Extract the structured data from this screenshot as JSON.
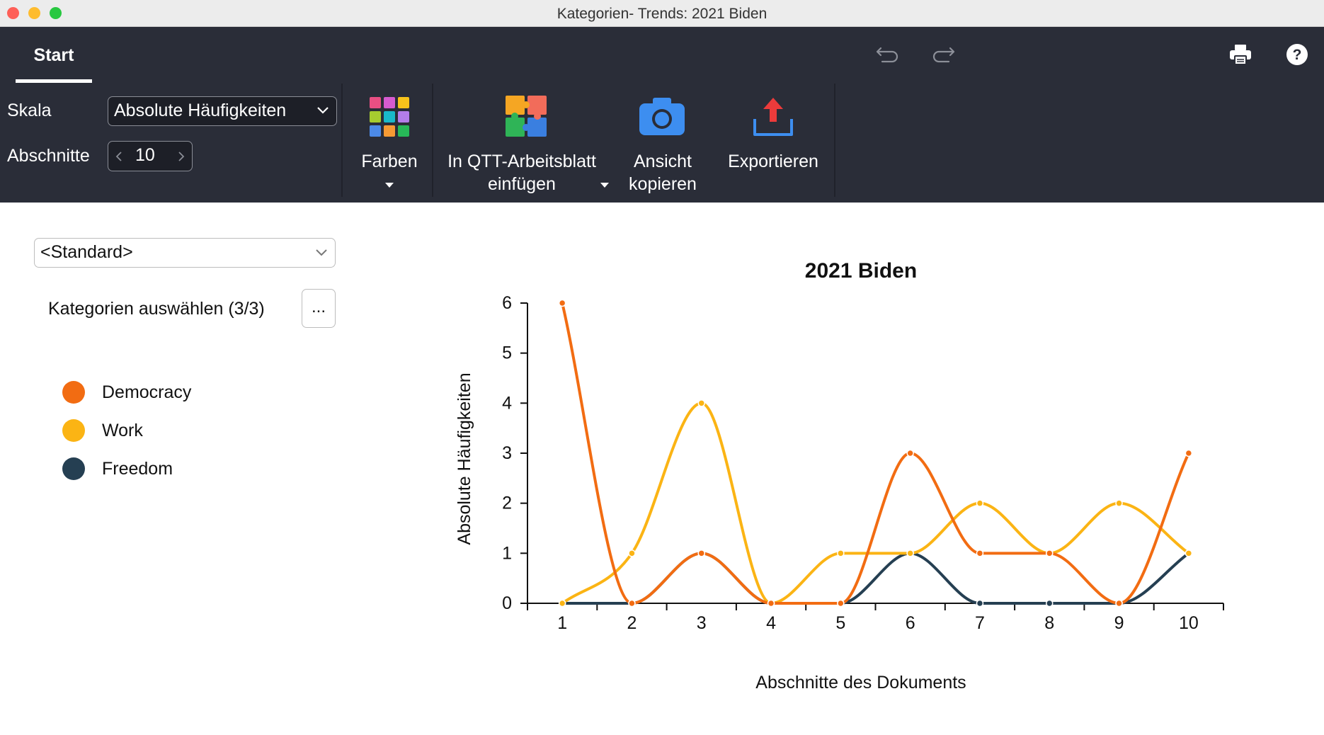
{
  "window": {
    "title": "Kategorien- Trends: 2021 Biden"
  },
  "tabs": [
    {
      "label": "Start"
    }
  ],
  "ribbon": {
    "skala_label": "Skala",
    "skala_value": "Absolute Häufigkeiten",
    "abschnitte_label": "Abschnitte",
    "abschnitte_value": "10",
    "farben_label": "Farben",
    "qtt_label_line1": "In QTT-Arbeitsblatt",
    "qtt_label_line2": "einfügen",
    "ansicht_line1": "Ansicht",
    "ansicht_line2": "kopieren",
    "export_label": "Exportieren"
  },
  "sidebar": {
    "preset_value": "<Standard>",
    "kategorien_label": "Kategorien auswählen (3/3)",
    "kategorien_button": "...",
    "legend": [
      {
        "name": "Democracy",
        "color": "#f26c12"
      },
      {
        "name": "Work",
        "color": "#fbb414"
      },
      {
        "name": "Freedom",
        "color": "#253f52"
      }
    ]
  },
  "colors": {
    "toolbar_bg": "#2a2d38",
    "farben_grid": [
      "#e94f83",
      "#d65bd0",
      "#f7c31b",
      "#a6cc2f",
      "#19b9c9",
      "#b37de9",
      "#4c8ae8",
      "#f59a34",
      "#27b858"
    ]
  },
  "chart_data": {
    "type": "line",
    "title": "2021 Biden",
    "xlabel": "Abschnitte des Dokuments",
    "ylabel": "Absolute Häufigkeiten",
    "categories": [
      "1",
      "2",
      "3",
      "4",
      "5",
      "6",
      "7",
      "8",
      "9",
      "10"
    ],
    "ylim": [
      0,
      6
    ],
    "yticks": [
      0,
      1,
      2,
      3,
      4,
      5,
      6
    ],
    "grid": false,
    "series": [
      {
        "name": "Democracy",
        "color": "#f26c12",
        "values": [
          6,
          0,
          1,
          0,
          0,
          3,
          1,
          1,
          0,
          3
        ]
      },
      {
        "name": "Work",
        "color": "#fbb414",
        "values": [
          0,
          1,
          4,
          0,
          1,
          1,
          2,
          1,
          2,
          1
        ]
      },
      {
        "name": "Freedom",
        "color": "#253f52",
        "values": [
          0,
          0,
          1,
          0,
          0,
          1,
          0,
          0,
          0,
          1
        ]
      }
    ]
  }
}
